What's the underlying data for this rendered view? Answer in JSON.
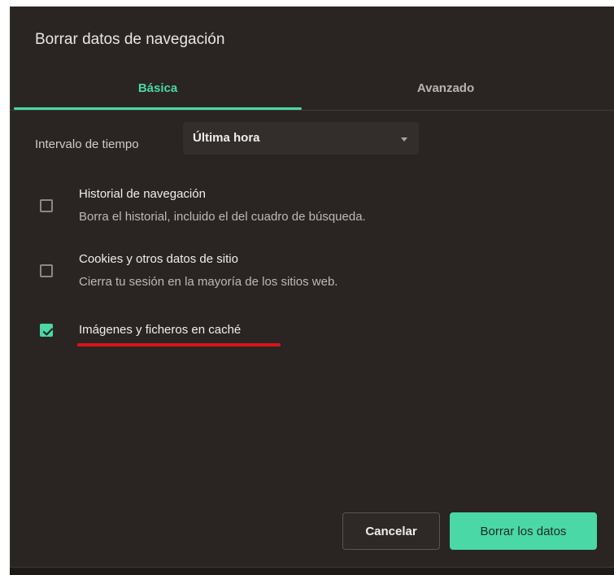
{
  "dialog": {
    "title": "Borrar datos de navegación",
    "tabs": [
      {
        "label": "Básica",
        "active": true
      },
      {
        "label": "Avanzado",
        "active": false
      }
    ],
    "time_range": {
      "label": "Intervalo de tiempo",
      "selected": "Última hora"
    },
    "options": [
      {
        "title": "Historial de navegación",
        "description": "Borra el historial, incluido el del cuadro de búsqueda.",
        "checked": false
      },
      {
        "title": "Cookies y otros datos de sitio",
        "description": "Cierra tu sesión en la mayoría de los sitios web.",
        "checked": false
      },
      {
        "title": "Imágenes y ficheros en caché",
        "description": "",
        "checked": true
      }
    ],
    "buttons": {
      "cancel_label": "Cancelar",
      "confirm_label": "Borrar los datos"
    }
  },
  "colors": {
    "accent": "#4ad8a6",
    "background": "#2a2522",
    "annotation_underline": "#d8141c"
  }
}
